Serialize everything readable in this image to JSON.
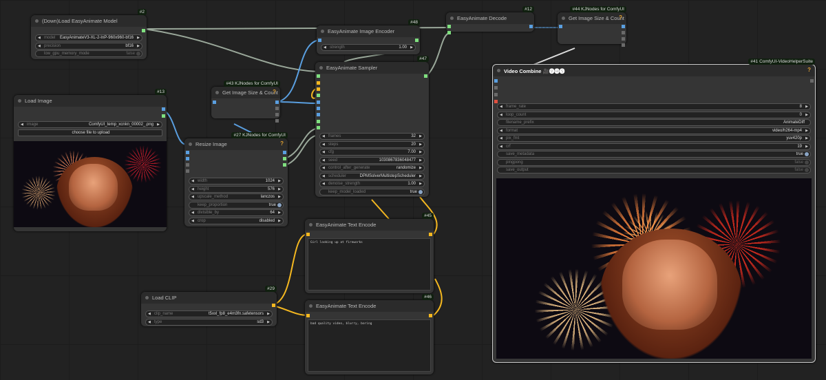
{
  "nodes": {
    "load_model": {
      "badge": "#2",
      "title": "(Down)Load EasyAnimate Model",
      "widgets": [
        {
          "label": "model",
          "value": "EasyAnimateV3-XL-2-InP-960x960-bf16",
          "type": "combo"
        },
        {
          "label": "precision",
          "value": "bf16",
          "type": "combo"
        },
        {
          "label": "low_gpu_memory_mode",
          "value": "false",
          "type": "toggle-off"
        }
      ]
    },
    "load_image": {
      "badge": "#13",
      "title": "Load Image",
      "widgets": [
        {
          "label": "image",
          "value": "ComfyUI_temp_xcnkn_00002_.png",
          "type": "combo"
        },
        {
          "label": "",
          "value": "choose file to upload",
          "type": "button"
        }
      ]
    },
    "size43": {
      "badge": "#43 KJNodes for ComfyUI",
      "title": "Get Image Size & Count",
      "help": "?",
      "widgets": []
    },
    "resize": {
      "badge": "#27 KJNodes for ComfyUI",
      "title": "Resize Image",
      "help": "?",
      "widgets": [
        {
          "label": "width",
          "value": "1024",
          "type": "combo"
        },
        {
          "label": "height",
          "value": "576",
          "type": "combo"
        },
        {
          "label": "upscale_method",
          "value": "lanczos",
          "type": "combo"
        },
        {
          "label": "keep_proportion",
          "value": "true",
          "type": "toggle-on"
        },
        {
          "label": "divisible_by",
          "value": "64",
          "type": "combo"
        },
        {
          "label": "crop",
          "value": "disabled",
          "type": "combo"
        }
      ]
    },
    "encoder": {
      "badge": "#48",
      "title": "EasyAnimate Image Encoder",
      "widgets": [
        {
          "label": "strength",
          "value": "1.00",
          "type": "combo"
        }
      ]
    },
    "sampler": {
      "badge": "#47",
      "title": "EasyAnimate Sampler",
      "widgets": [
        {
          "label": "frames",
          "value": "32",
          "type": "combo"
        },
        {
          "label": "steps",
          "value": "20",
          "type": "combo"
        },
        {
          "label": "cfg",
          "value": "7.00",
          "type": "combo"
        },
        {
          "label": "seed",
          "value": "1030867836048477",
          "type": "combo"
        },
        {
          "label": "control_after_generate",
          "value": "randomize",
          "type": "combo"
        },
        {
          "label": "scheduler",
          "value": "DPMSolverMultistepScheduler",
          "type": "combo"
        },
        {
          "label": "denoise_strength",
          "value": "1.00",
          "type": "combo"
        },
        {
          "label": "keep_model_loaded",
          "value": "true",
          "type": "toggle-on"
        }
      ]
    },
    "decode": {
      "badge": "#12",
      "title": "EasyAnimate Decode",
      "widgets": []
    },
    "size44": {
      "badge": "#44 KJNodes for ComfyUI",
      "title": "Get Image Size & Count",
      "help": "?",
      "widgets": []
    },
    "video": {
      "badge": "#41 ComfyUI-VideoHelperSuite",
      "title": "Video Combine 🎥🅥🅗🅢",
      "help": "?",
      "widgets": [
        {
          "label": "frame_rate",
          "value": "8",
          "type": "combo"
        },
        {
          "label": "loop_count",
          "value": "0",
          "type": "combo"
        },
        {
          "label": "filename_prefix",
          "value": "AnimateDiff",
          "type": "string"
        },
        {
          "label": "format",
          "value": "video/h264-mp4",
          "type": "combo"
        },
        {
          "label": "pix_fmt",
          "value": "yuv420p",
          "type": "combo"
        },
        {
          "label": "crf",
          "value": "19",
          "type": "combo"
        },
        {
          "label": "save_metadata",
          "value": "true",
          "type": "toggle-on"
        },
        {
          "label": "pingpong",
          "value": "false",
          "type": "toggle-off"
        },
        {
          "label": "save_output",
          "value": "false",
          "type": "toggle-off"
        }
      ]
    },
    "text45": {
      "badge": "#45",
      "title": "EasyAnimate Text Encode",
      "text": "Girl looking up at fireworks",
      "widgets": []
    },
    "text46": {
      "badge": "#46",
      "title": "EasyAnimate Text Encode",
      "text": "bad quality video, blurry, boring",
      "widgets": []
    },
    "clip": {
      "badge": "#29",
      "title": "Load CLIP",
      "widgets": [
        {
          "label": "clip_name",
          "value": "t5xxl_fp8_e4m3fn.safetensors",
          "type": "combo"
        },
        {
          "label": "type",
          "value": "sd3",
          "type": "combo"
        }
      ]
    }
  },
  "colors": {
    "image": "#5a9fe0",
    "latent": "#f0a0c0",
    "model": "#7fe07f",
    "clip": "#f5b820",
    "mask": "#6a6a6a",
    "audio": "#e05040"
  }
}
